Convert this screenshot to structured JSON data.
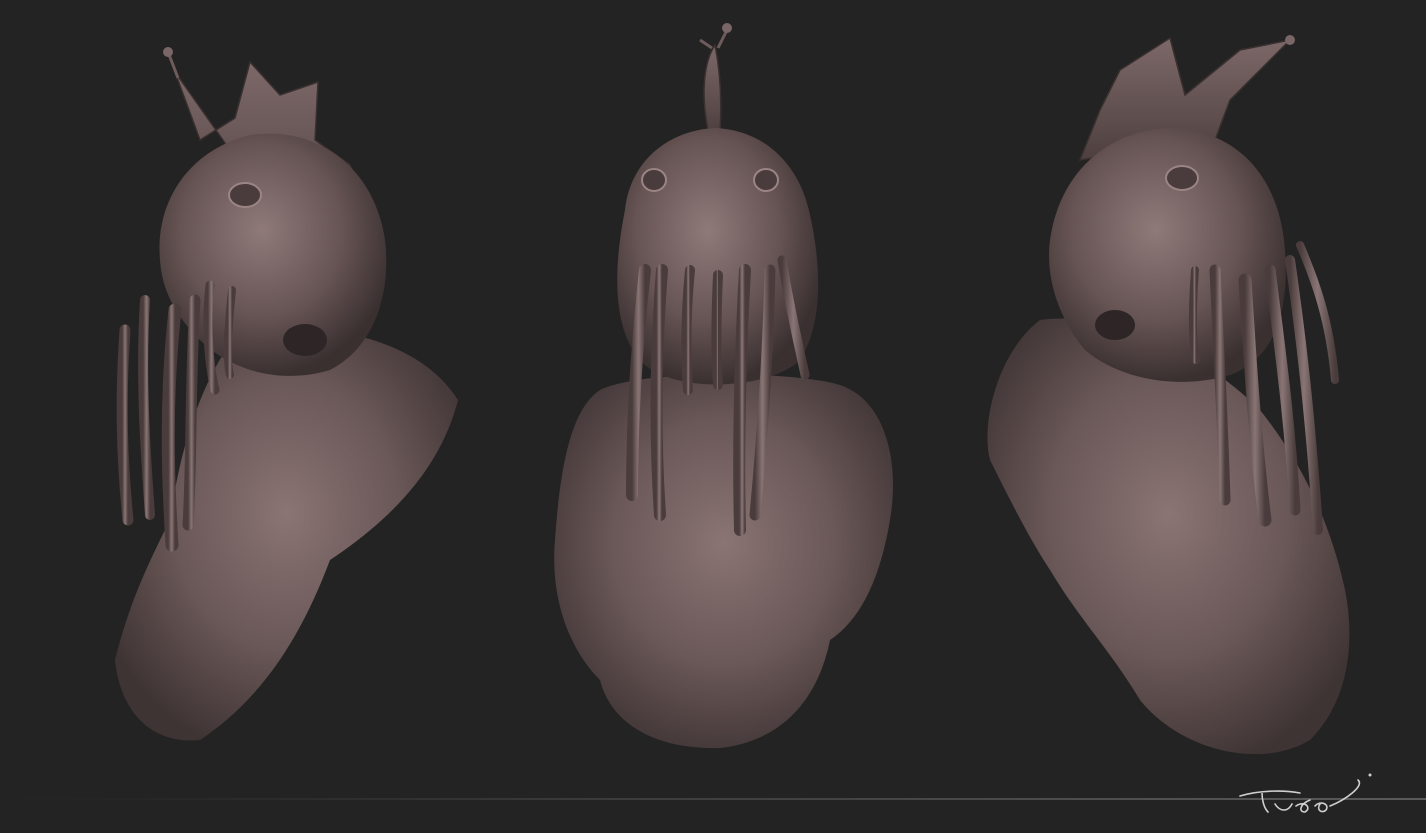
{
  "scene": {
    "background_color": "#232323",
    "clay_color": "#6b5858",
    "clay_highlight": "#8c7777",
    "clay_shadow": "#3a3030",
    "signature_text": "Tudor"
  },
  "views": [
    {
      "name": "left-three-quarter-view"
    },
    {
      "name": "front-view"
    },
    {
      "name": "right-three-quarter-view"
    }
  ]
}
